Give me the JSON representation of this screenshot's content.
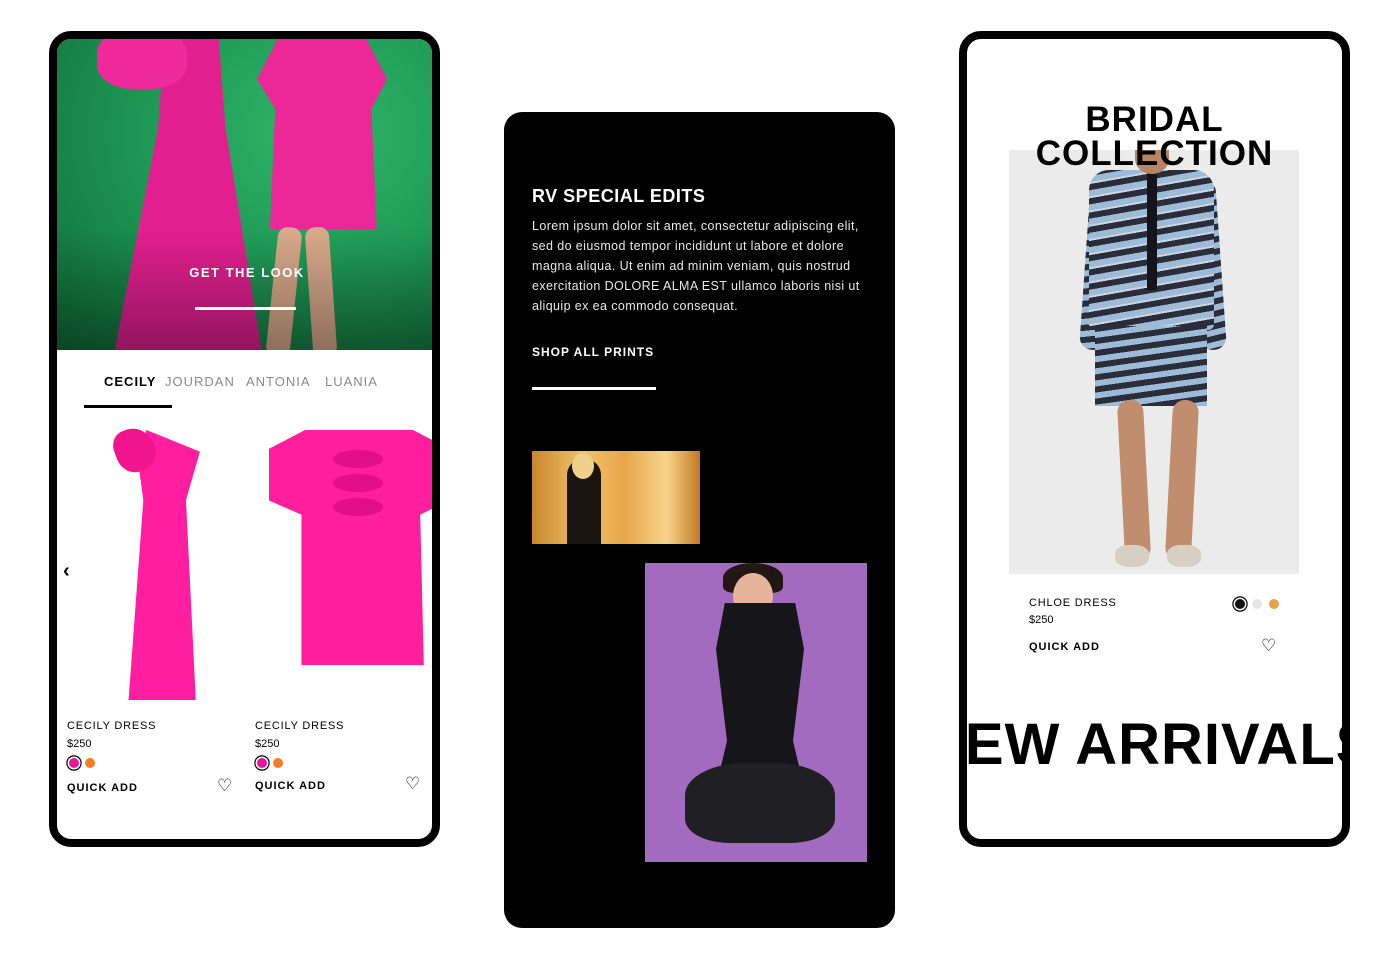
{
  "phone1": {
    "hero_cta": "GET THE LOOK",
    "tabs": [
      "CECILY",
      "JOURDAN",
      "ANTONIA",
      "LUANIA"
    ],
    "active_tab": "CECILY",
    "prev_icon": "chevron-left-icon",
    "next_icon": "chevron-right-icon",
    "products": [
      {
        "name": "CECILY DRESS",
        "price": "$250",
        "swatches": [
          "#e7159a",
          "#f57c23"
        ],
        "quick_add": "QUICK ADD",
        "heart_icon": "heart-icon"
      },
      {
        "name": "CECILY DRESS",
        "price": "$250",
        "swatches": [
          "#e7159a",
          "#f57c23"
        ],
        "quick_add": "QUICK ADD",
        "heart_icon": "heart-icon"
      }
    ]
  },
  "phone2": {
    "title": "RV SPECIAL EDITS",
    "body": "Lorem ipsum dolor sit amet, consectetur adipiscing elit, sed do eiusmod tempor incididunt ut labore et dolore magna aliqua. Ut enim ad minim veniam, quis nostrud exercitation DOLORE ALMA EST ullamco laboris nisi ut aliquip ex ea commodo consequat.",
    "link": "SHOP ALL PRINTS"
  },
  "phone3": {
    "heading_line1": "BRIDAL",
    "heading_line2": "COLLECTION",
    "product": {
      "name": "CHLOE DRESS",
      "price": "$250",
      "swatches": [
        "#111111",
        "#e6e6e6",
        "#e8a04a"
      ],
      "quick_add": "QUICK ADD",
      "heart_icon": "heart-icon"
    },
    "marquee": "NEW ARRIVALS"
  },
  "colors": {
    "hero_green": "#1f9a55",
    "pink": "#ff1da0",
    "black": "#000000"
  }
}
